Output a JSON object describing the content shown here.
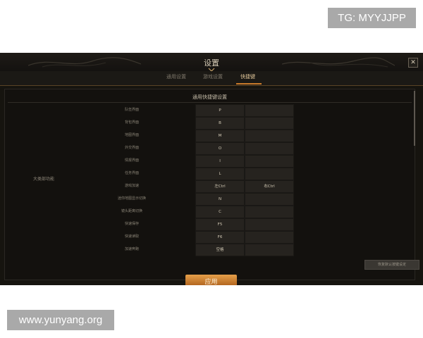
{
  "watermarks": {
    "top_right": "TG: MYYJJPP",
    "bottom_left": "www.yunyang.org"
  },
  "window": {
    "title": "设置",
    "close_glyph": "✕",
    "tabs": [
      {
        "label": "通用设置",
        "active": false
      },
      {
        "label": "游戏设置",
        "active": false
      },
      {
        "label": "快捷键",
        "active": true
      }
    ]
  },
  "keybindings": {
    "section_title": "通用快捷键设置",
    "group_label": "大类部功能",
    "rows": [
      {
        "label": "队伍界面",
        "key1": "P",
        "key2": ""
      },
      {
        "label": "背包界面",
        "key1": "B",
        "key2": ""
      },
      {
        "label": "地图界面",
        "key1": "M",
        "key2": ""
      },
      {
        "label": "外交界面",
        "key1": "O",
        "key2": ""
      },
      {
        "label": "情报界面",
        "key1": "I",
        "key2": ""
      },
      {
        "label": "任务界面",
        "key1": "L",
        "key2": ""
      },
      {
        "label": "游戏加速",
        "key1": "左Ctrl",
        "key2": "右Ctrl"
      },
      {
        "label": "迷你地图显示切换",
        "key1": "N",
        "key2": ""
      },
      {
        "label": "镜头距离切换",
        "key1": "C",
        "key2": ""
      },
      {
        "label": "快速保存",
        "key1": "F5",
        "key2": ""
      },
      {
        "label": "快速读取",
        "key1": "F6",
        "key2": ""
      },
      {
        "label": "加速奔跑",
        "key1": "空格",
        "key2": ""
      }
    ]
  },
  "buttons": {
    "reset_label": "恢复默认按键设定",
    "apply_label": "应用"
  },
  "colors": {
    "background": "#16140f",
    "accent_gold": "#c97a2a",
    "text_light": "#d8cdb8",
    "key_cell": "#26231f"
  },
  "icons": {
    "close": "close-icon",
    "title_chevron": "chevron-down-icon"
  }
}
